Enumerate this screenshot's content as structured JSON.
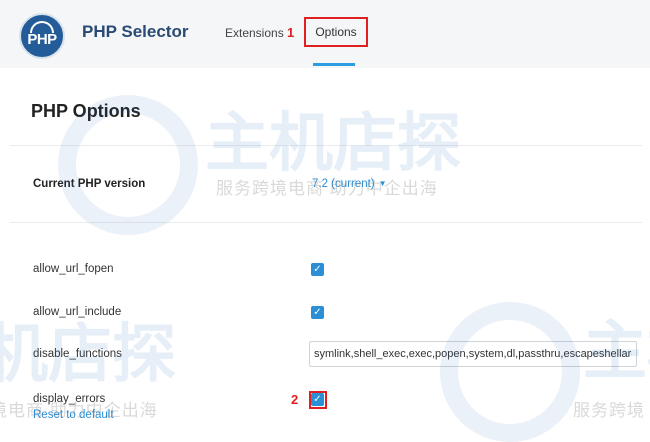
{
  "header": {
    "logo_text": "PHP",
    "app_title": "PHP Selector",
    "tabs": [
      {
        "label": "Extensions"
      },
      {
        "label": "Options",
        "active": true
      }
    ],
    "annotation_marker_1": "1"
  },
  "main": {
    "section_title": "PHP Options",
    "current_version": {
      "label": "Current PHP version",
      "value": "7.2 (current)"
    },
    "options": [
      {
        "label": "allow_url_fopen",
        "checked": true
      },
      {
        "label": "allow_url_include",
        "checked": true
      },
      {
        "label": "disable_functions",
        "value": "symlink,shell_exec,exec,popen,system,dl,passthru,escapeshellarg"
      },
      {
        "label": "display_errors",
        "checked": true
      }
    ],
    "annotation_marker_2": "2",
    "reset_link": "Reset to default"
  },
  "watermark": {
    "text_large": "主机店探",
    "text_sub": "服务跨境电商 助力中企出海",
    "text_sub_short": "服务跨境"
  },
  "colors": {
    "accent": "#2b8fd6",
    "annotation_red": "#e02020",
    "title_blue": "#2a4a73"
  }
}
